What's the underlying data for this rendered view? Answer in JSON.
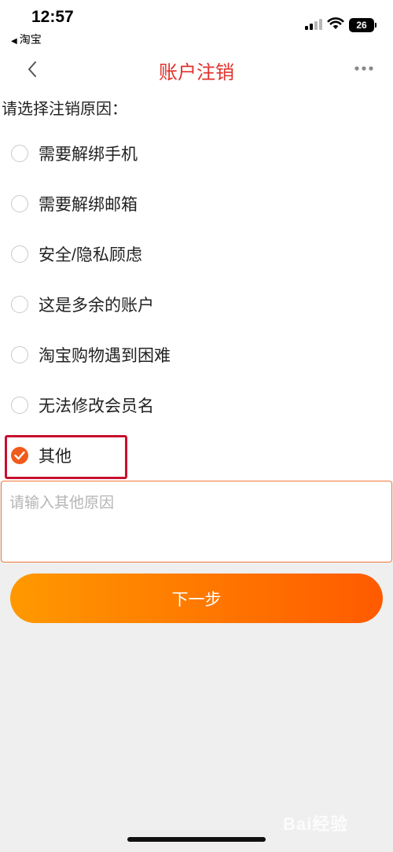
{
  "status_bar": {
    "time": "12:57",
    "back_app": "淘宝",
    "battery": "26"
  },
  "nav": {
    "title": "账户注销",
    "back_icon": "chevron-left-icon",
    "more_icon": "more-dots-icon"
  },
  "form": {
    "prompt": "请选择注销原因：",
    "options": [
      {
        "label": "需要解绑手机",
        "checked": false
      },
      {
        "label": "需要解绑邮箱",
        "checked": false
      },
      {
        "label": "安全/隐私顾虑",
        "checked": false
      },
      {
        "label": "这是多余的账户",
        "checked": false
      },
      {
        "label": "淘宝购物遇到困难",
        "checked": false
      },
      {
        "label": "无法修改会员名",
        "checked": false
      },
      {
        "label": "其他",
        "checked": true
      }
    ],
    "other_reason": {
      "value": "",
      "placeholder": "请输入其他原因"
    },
    "next_label": "下一步"
  },
  "colors": {
    "title": "#e0312a",
    "accent": "#f05a1a",
    "highlight_box": "#c8102e",
    "button_gradient_start": "#ff9900",
    "button_gradient_end": "#ff5a00"
  },
  "watermark": "Bai经验"
}
